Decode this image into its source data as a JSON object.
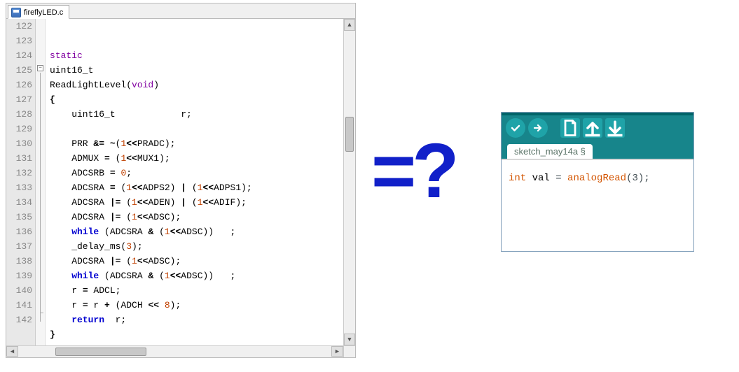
{
  "left": {
    "tab_filename": "fireflyLED.c",
    "first_line_no": 122,
    "lines": [
      [
        {
          "t": "static",
          "c": "kw2"
        }
      ],
      [
        {
          "t": "uint16_t",
          "c": "id"
        }
      ],
      [
        {
          "t": "ReadLightLevel(",
          "c": "id"
        },
        {
          "t": "void",
          "c": "kw2"
        },
        {
          "t": ")",
          "c": "id"
        }
      ],
      [
        {
          "t": "{",
          "c": "op"
        }
      ],
      [
        {
          "t": "    uint16_t            r;",
          "c": "id"
        }
      ],
      [],
      [
        {
          "t": "    PRR ",
          "c": "id"
        },
        {
          "t": "&= ~",
          "c": "op"
        },
        {
          "t": "(",
          "c": "id"
        },
        {
          "t": "1",
          "c": "num"
        },
        {
          "t": "<<",
          "c": "op"
        },
        {
          "t": "PRADC);",
          "c": "id"
        }
      ],
      [
        {
          "t": "    ADMUX ",
          "c": "id"
        },
        {
          "t": "= ",
          "c": "op"
        },
        {
          "t": "(",
          "c": "id"
        },
        {
          "t": "1",
          "c": "num"
        },
        {
          "t": "<<",
          "c": "op"
        },
        {
          "t": "MUX1);",
          "c": "id"
        }
      ],
      [
        {
          "t": "    ADCSRB ",
          "c": "id"
        },
        {
          "t": "= ",
          "c": "op"
        },
        {
          "t": "0",
          "c": "num"
        },
        {
          "t": ";",
          "c": "id"
        }
      ],
      [
        {
          "t": "    ADCSRA ",
          "c": "id"
        },
        {
          "t": "= ",
          "c": "op"
        },
        {
          "t": "(",
          "c": "id"
        },
        {
          "t": "1",
          "c": "num"
        },
        {
          "t": "<<",
          "c": "op"
        },
        {
          "t": "ADPS2) ",
          "c": "id"
        },
        {
          "t": "| ",
          "c": "op"
        },
        {
          "t": "(",
          "c": "id"
        },
        {
          "t": "1",
          "c": "num"
        },
        {
          "t": "<<",
          "c": "op"
        },
        {
          "t": "ADPS1);",
          "c": "id"
        }
      ],
      [
        {
          "t": "    ADCSRA ",
          "c": "id"
        },
        {
          "t": "|= ",
          "c": "op"
        },
        {
          "t": "(",
          "c": "id"
        },
        {
          "t": "1",
          "c": "num"
        },
        {
          "t": "<<",
          "c": "op"
        },
        {
          "t": "ADEN) ",
          "c": "id"
        },
        {
          "t": "| ",
          "c": "op"
        },
        {
          "t": "(",
          "c": "id"
        },
        {
          "t": "1",
          "c": "num"
        },
        {
          "t": "<<",
          "c": "op"
        },
        {
          "t": "ADIF);",
          "c": "id"
        }
      ],
      [
        {
          "t": "    ADCSRA ",
          "c": "id"
        },
        {
          "t": "|= ",
          "c": "op"
        },
        {
          "t": "(",
          "c": "id"
        },
        {
          "t": "1",
          "c": "num"
        },
        {
          "t": "<<",
          "c": "op"
        },
        {
          "t": "ADSC);",
          "c": "id"
        }
      ],
      [
        {
          "t": "    ",
          "c": "id"
        },
        {
          "t": "while",
          "c": "kw"
        },
        {
          "t": " (ADCSRA ",
          "c": "id"
        },
        {
          "t": "& ",
          "c": "op"
        },
        {
          "t": "(",
          "c": "id"
        },
        {
          "t": "1",
          "c": "num"
        },
        {
          "t": "<<",
          "c": "op"
        },
        {
          "t": "ADSC))   ;",
          "c": "id"
        }
      ],
      [
        {
          "t": "    _delay_ms(",
          "c": "id"
        },
        {
          "t": "3",
          "c": "num"
        },
        {
          "t": ");",
          "c": "id"
        }
      ],
      [
        {
          "t": "    ADCSRA ",
          "c": "id"
        },
        {
          "t": "|= ",
          "c": "op"
        },
        {
          "t": "(",
          "c": "id"
        },
        {
          "t": "1",
          "c": "num"
        },
        {
          "t": "<<",
          "c": "op"
        },
        {
          "t": "ADSC);",
          "c": "id"
        }
      ],
      [
        {
          "t": "    ",
          "c": "id"
        },
        {
          "t": "while",
          "c": "kw"
        },
        {
          "t": " (ADCSRA ",
          "c": "id"
        },
        {
          "t": "& ",
          "c": "op"
        },
        {
          "t": "(",
          "c": "id"
        },
        {
          "t": "1",
          "c": "num"
        },
        {
          "t": "<<",
          "c": "op"
        },
        {
          "t": "ADSC))   ;",
          "c": "id"
        }
      ],
      [
        {
          "t": "    r ",
          "c": "id"
        },
        {
          "t": "= ",
          "c": "op"
        },
        {
          "t": "ADCL;",
          "c": "id"
        }
      ],
      [
        {
          "t": "    r ",
          "c": "id"
        },
        {
          "t": "= ",
          "c": "op"
        },
        {
          "t": "r ",
          "c": "id"
        },
        {
          "t": "+ ",
          "c": "op"
        },
        {
          "t": "(ADCH ",
          "c": "id"
        },
        {
          "t": "<< ",
          "c": "op"
        },
        {
          "t": "8",
          "c": "num"
        },
        {
          "t": ");",
          "c": "id"
        }
      ],
      [
        {
          "t": "    ",
          "c": "id"
        },
        {
          "t": "return",
          "c": "kw"
        },
        {
          "t": "  r;",
          "c": "id"
        }
      ],
      [
        {
          "t": "}",
          "c": "op"
        }
      ],
      []
    ]
  },
  "center": {
    "symbol": "=?"
  },
  "right": {
    "tab_label": "sketch_may14a §",
    "code": {
      "type": "int",
      "rest1": " val ",
      "eq": "=",
      "rest2": " ",
      "fn": "analogRead",
      "args": "(3);"
    },
    "icons": [
      "check",
      "arrow-right",
      "new",
      "upload",
      "download"
    ]
  }
}
